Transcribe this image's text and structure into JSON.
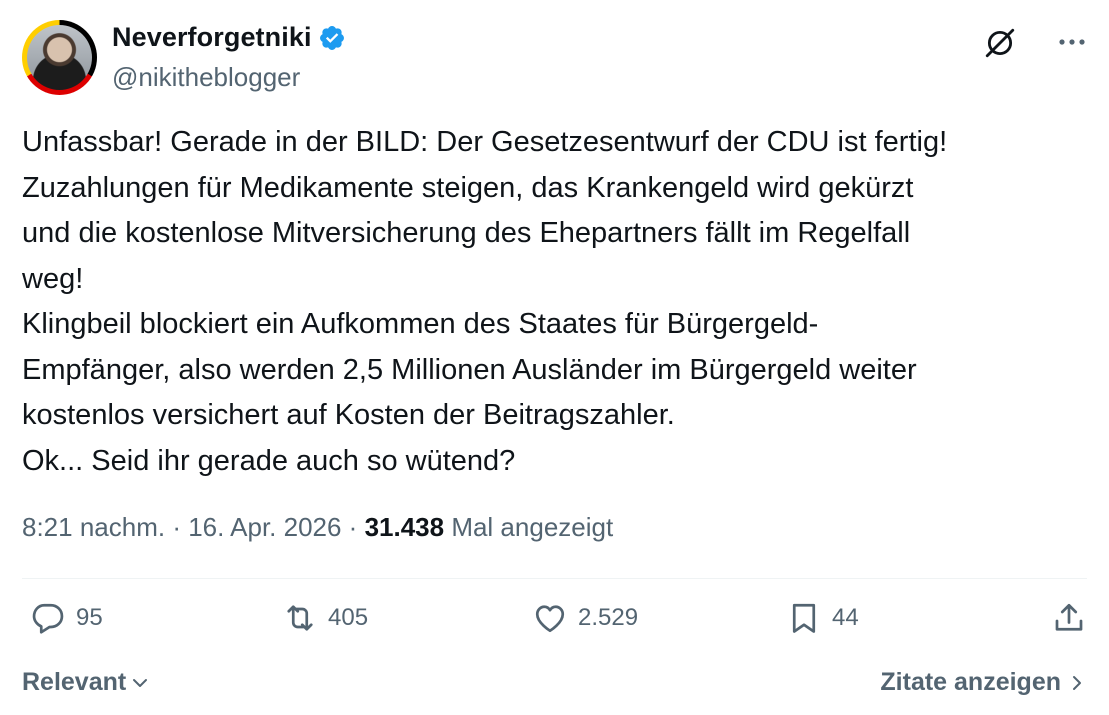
{
  "author": {
    "display_name": "Neverforgetniki",
    "handle": "@nikitheblogger",
    "verified_color": "#1d9bf0"
  },
  "tweet": {
    "text": "Unfassbar! Gerade in der BILD: Der Gesetzesentwurf der CDU ist fertig!\nZuzahlungen für Medikamente steigen, das Krankengeld wird gekürzt\nund die kostenlose Mitversicherung des Ehepartners fällt im Regelfall\nweg!\nKlingbeil blockiert ein Aufkommen des Staates für Bürgergeld-\nEmpfänger, also werden 2,5 Millionen Ausländer im Bürgergeld weiter\nkostenlos versichert auf Kosten der Beitragszahler.\nOk... Seid ihr gerade auch so wütend?"
  },
  "meta": {
    "time": "8:21 nachm.",
    "separator1": " · ",
    "date": "16. Apr. 2026",
    "separator2": " · ",
    "views_count": "31.438",
    "views_label": " Mal angezeigt"
  },
  "actions": {
    "replies": "95",
    "reposts": "405",
    "likes": "2.529",
    "bookmarks": "44"
  },
  "footer": {
    "sort_label": "Relevant",
    "quotes_label": "Zitate anzeigen"
  },
  "icons": {
    "verified": "verified-badge-icon",
    "grok": "grok-icon",
    "more": "more-icon",
    "reply": "reply-icon",
    "retweet": "retweet-icon",
    "like": "heart-icon",
    "bookmark": "bookmark-icon",
    "share": "share-icon"
  }
}
